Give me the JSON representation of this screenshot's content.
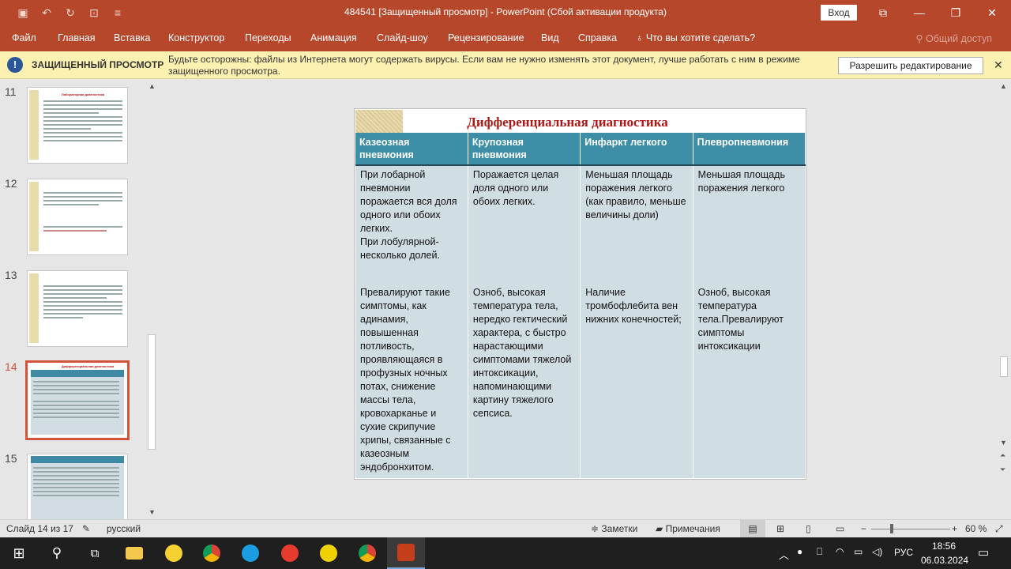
{
  "window": {
    "title": "484541 [Защищенный просмотр]  -  PowerPoint (Сбой активации продукта)",
    "login_label": "Вход"
  },
  "qat": {
    "save_icon": "save-icon",
    "undo_icon": "undo-icon",
    "redo_icon": "redo-icon",
    "present_icon": "present-icon",
    "more_icon": "more-icon"
  },
  "ribbon": {
    "tabs": [
      "Файл",
      "Главная",
      "Вставка",
      "Конструктор",
      "Переходы",
      "Анимация",
      "Слайд-шоу",
      "Рецензирование",
      "Вид",
      "Справка",
      "Что вы хотите сделать?"
    ],
    "share_label": "Общий доступ"
  },
  "protected_view": {
    "title": "ЗАЩИЩЕННЫЙ ПРОСМОТР",
    "message": "Будьте осторожны: файлы из Интернета могут содержать вирусы. Если вам не нужно изменять этот документ, лучше работать с ним в режиме защищенного просмотра.",
    "enable_button": "Разрешить редактирование"
  },
  "thumbnails": [
    {
      "number": "11",
      "title": "Лабораторная диагностика"
    },
    {
      "number": "12"
    },
    {
      "number": "13"
    },
    {
      "number": "14",
      "title": "Дифференциальная диагностика"
    },
    {
      "number": "15"
    }
  ],
  "slide": {
    "title": "Дифференциальная диагностика",
    "headers": [
      "Казеозная пневмония",
      "Крупозная пневмония",
      "Инфаркт легкого",
      "Плевропневмония"
    ],
    "rows": [
      [
        "При лобарной пневмонии поражается вся доля одного или обоих легких.\nПри лобулярной- несколько долей.",
        "Поражается целая доля одного или обоих легких.",
        "Меньшая площадь поражения легкого (как правило, меньше величины доли)",
        "Меньшая площадь поражения легкого"
      ],
      [
        "Превалируют такие симптомы, как адинамия, повышенная потливость, проявляющаяся в профузных ночных потах, снижение массы тела, кровохарканье и сухие скрипучие хрипы, связанные с казеозным эндобронхитом.",
        "Озноб, высокая температура тела, нередко гектический характера, с быстро нарастающими симптомами тяжелой интоксикации, напоминающими картину тяжелого сепсиса.",
        "Наличие тромбофлебита вен нижних конечностей;",
        "Озноб, высокая температура тела.Превалируют симптомы интоксикации"
      ]
    ]
  },
  "statusbar": {
    "slide_info": "Слайд 14 из 17",
    "language": "русский",
    "notes_label": "Заметки",
    "comments_label": "Примечания",
    "zoom": "60 %"
  },
  "taskbar": {
    "lang": "РУС",
    "time": "18:56",
    "date": "06.03.2024"
  }
}
